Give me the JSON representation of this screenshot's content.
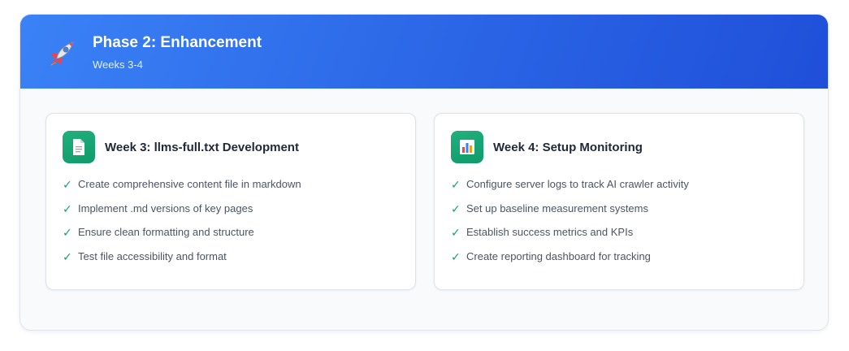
{
  "phase": {
    "icon": "rocket-icon",
    "title": "Phase 2: Enhancement",
    "subtitle": "Weeks 3-4"
  },
  "weeks": [
    {
      "icon": "document-icon",
      "title": "Week 3: llms-full.txt Development",
      "tasks": [
        "Create comprehensive content file in markdown",
        "Implement .md versions of key pages",
        "Ensure clean formatting and structure",
        "Test file accessibility and format"
      ]
    },
    {
      "icon": "bar-chart-icon",
      "title": "Week 4: Setup Monitoring",
      "tasks": [
        "Configure server logs to track AI crawler activity",
        "Set up baseline measurement systems",
        "Establish success metrics and KPIs",
        "Create reporting dashboard for tracking"
      ]
    }
  ],
  "check_mark": "✓",
  "colors": {
    "header_start": "#3b82f6",
    "header_end": "#1f4fd9",
    "accent_green": "#14a06e"
  }
}
